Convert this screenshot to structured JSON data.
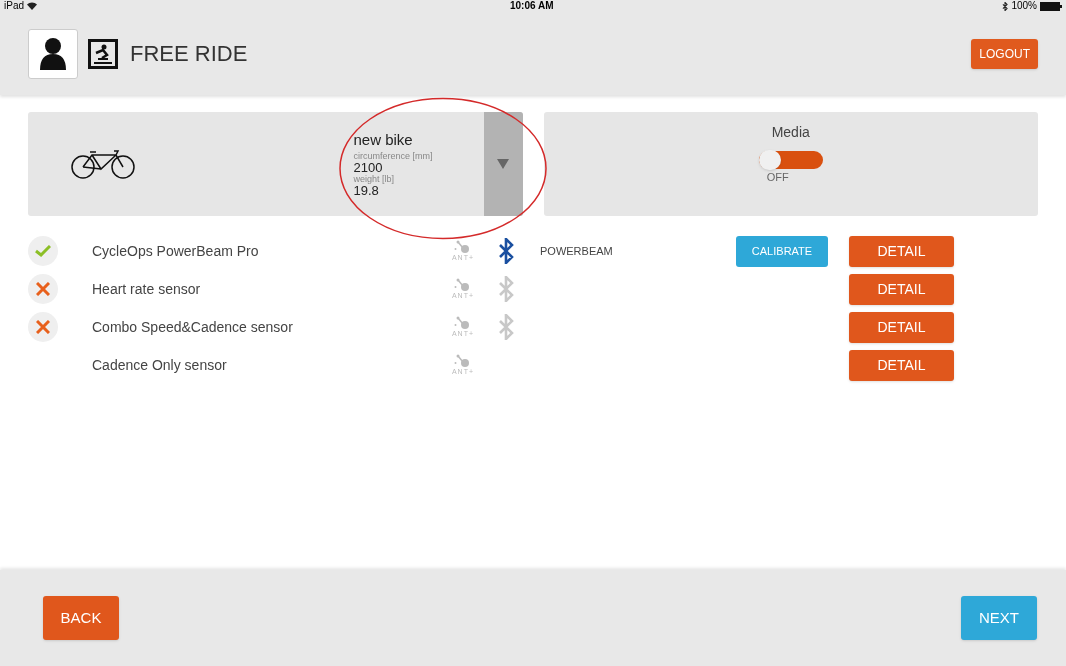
{
  "status_bar": {
    "device": "iPad",
    "time": "10:06 AM",
    "battery": "100%"
  },
  "header": {
    "title": "FREE RIDE",
    "logout": "LOGOUT"
  },
  "bike": {
    "name": "new bike",
    "circumference_label": "circumference [mm]",
    "circumference": "2100",
    "weight_label": "weight [lb]",
    "weight": "19.8"
  },
  "media": {
    "title": "Media",
    "on": false,
    "state_label": "OFF"
  },
  "sensors": [
    {
      "name": "CycleOps PowerBeam Pro",
      "connected": true,
      "ant": "ANT+",
      "bluetooth_on": true,
      "device": "POWERBEAM",
      "calibrate": "CALIBRATE",
      "detail": "DETAIL"
    },
    {
      "name": "Heart rate sensor",
      "connected": false,
      "ant": "ANT+",
      "bluetooth_on": false,
      "detail": "DETAIL"
    },
    {
      "name": "Combo Speed&Cadence sensor",
      "connected": false,
      "ant": "ANT+",
      "bluetooth_on": false,
      "detail": "DETAIL"
    },
    {
      "name": "Cadence Only sensor",
      "ant": "ANT+",
      "detail": "DETAIL"
    }
  ],
  "footer": {
    "back": "BACK",
    "next": "NEXT"
  }
}
